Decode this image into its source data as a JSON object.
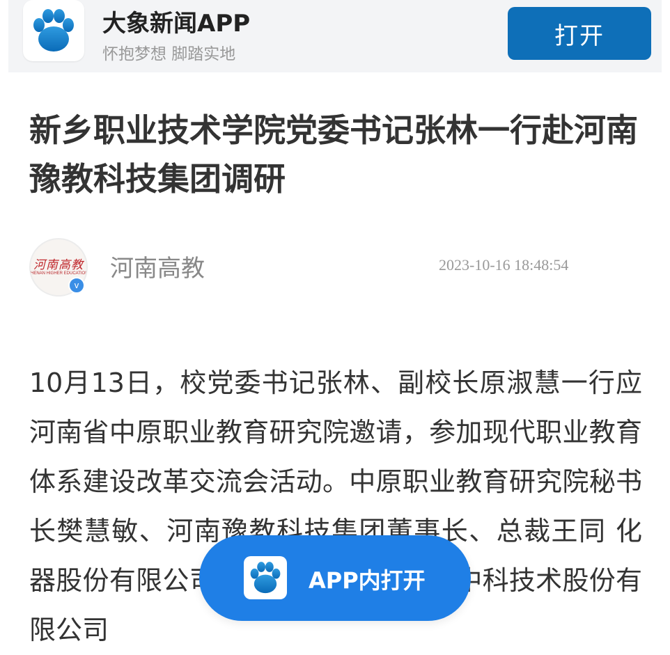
{
  "header": {
    "app_name": "大象新闻APP",
    "slogan": "怀抱梦想 脚踏实地",
    "open_label": "打开",
    "logo_icon": "paw-icon",
    "accent_color": "#0e6fb8"
  },
  "article": {
    "title": "新乡职业技术学院党委书记张林一行赴河南豫教科技集团调研",
    "author": {
      "name": "河南高教",
      "avatar_text_cn": "河南高教",
      "avatar_text_en": "HENAN HIGHER EDUCATION",
      "verified_icon": "verified-icon",
      "verified_mark": "v"
    },
    "datetime": "2023-10-16 18:48:54",
    "body": "10月13日，校党委书记张林、副校长原淑慧一行应河南省中原职业教育研究院邀请，参加现代职业教育体系建设改革交流会活动。中原职业教育研究院秘书长樊慧敏、河南豫教科技集团董事长、总裁王同 化器股份有限公司董事长张慧敏，龙芯中科技术股份有限公司"
  },
  "floating_button": {
    "label": "APP内打开",
    "color": "#1f7fe6"
  }
}
